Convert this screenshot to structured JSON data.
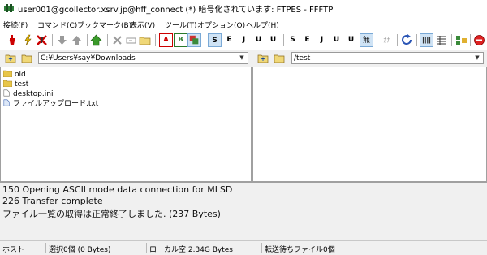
{
  "window": {
    "title": "user001@gcollector.xsrv.jp@hff_connect (*) 暗号化されています: FTPES - FFFTP"
  },
  "menu": {
    "items": [
      "接続(F)",
      "コマンド(C)",
      "ブックマーク(B)",
      "表示(V)",
      "ツール(T)",
      "オプション(O)",
      "ヘルプ(H)"
    ]
  },
  "toolbar": {
    "mode_a": "A",
    "mode_b": "B",
    "mode_kanji_left": [
      "S",
      "E",
      "J",
      "U",
      "U"
    ],
    "mode_kanji_right": [
      "S",
      "E",
      "J",
      "U",
      "U"
    ],
    "kana_label": "無",
    "kana_conv": "ｶﾅ"
  },
  "local": {
    "path": "C:¥Users¥say¥Downloads",
    "files": [
      {
        "name": "old",
        "icon": "folder-icon"
      },
      {
        "name": "test",
        "icon": "folder-icon"
      },
      {
        "name": "desktop.ini",
        "icon": "file-icon"
      },
      {
        "name": "ファイルアップロード.txt",
        "icon": "text-file-icon"
      }
    ]
  },
  "remote": {
    "path": "/test",
    "files": []
  },
  "log": {
    "lines": [
      "150 Opening ASCII mode data connection for MLSD",
      "226 Transfer complete",
      "ファイル一覧の取得は正常終了しました. (237 Bytes)"
    ]
  },
  "status": {
    "host": "ホスト",
    "selected": "選択0個 (0 Bytes)",
    "local_free": "ローカル空 2.34G Bytes",
    "queue": "転送待ちファイル0個"
  },
  "colors": {
    "folder": "#e8c64a",
    "selected_button": "#cfe3f5",
    "pane_border": "#a0a0a0"
  }
}
